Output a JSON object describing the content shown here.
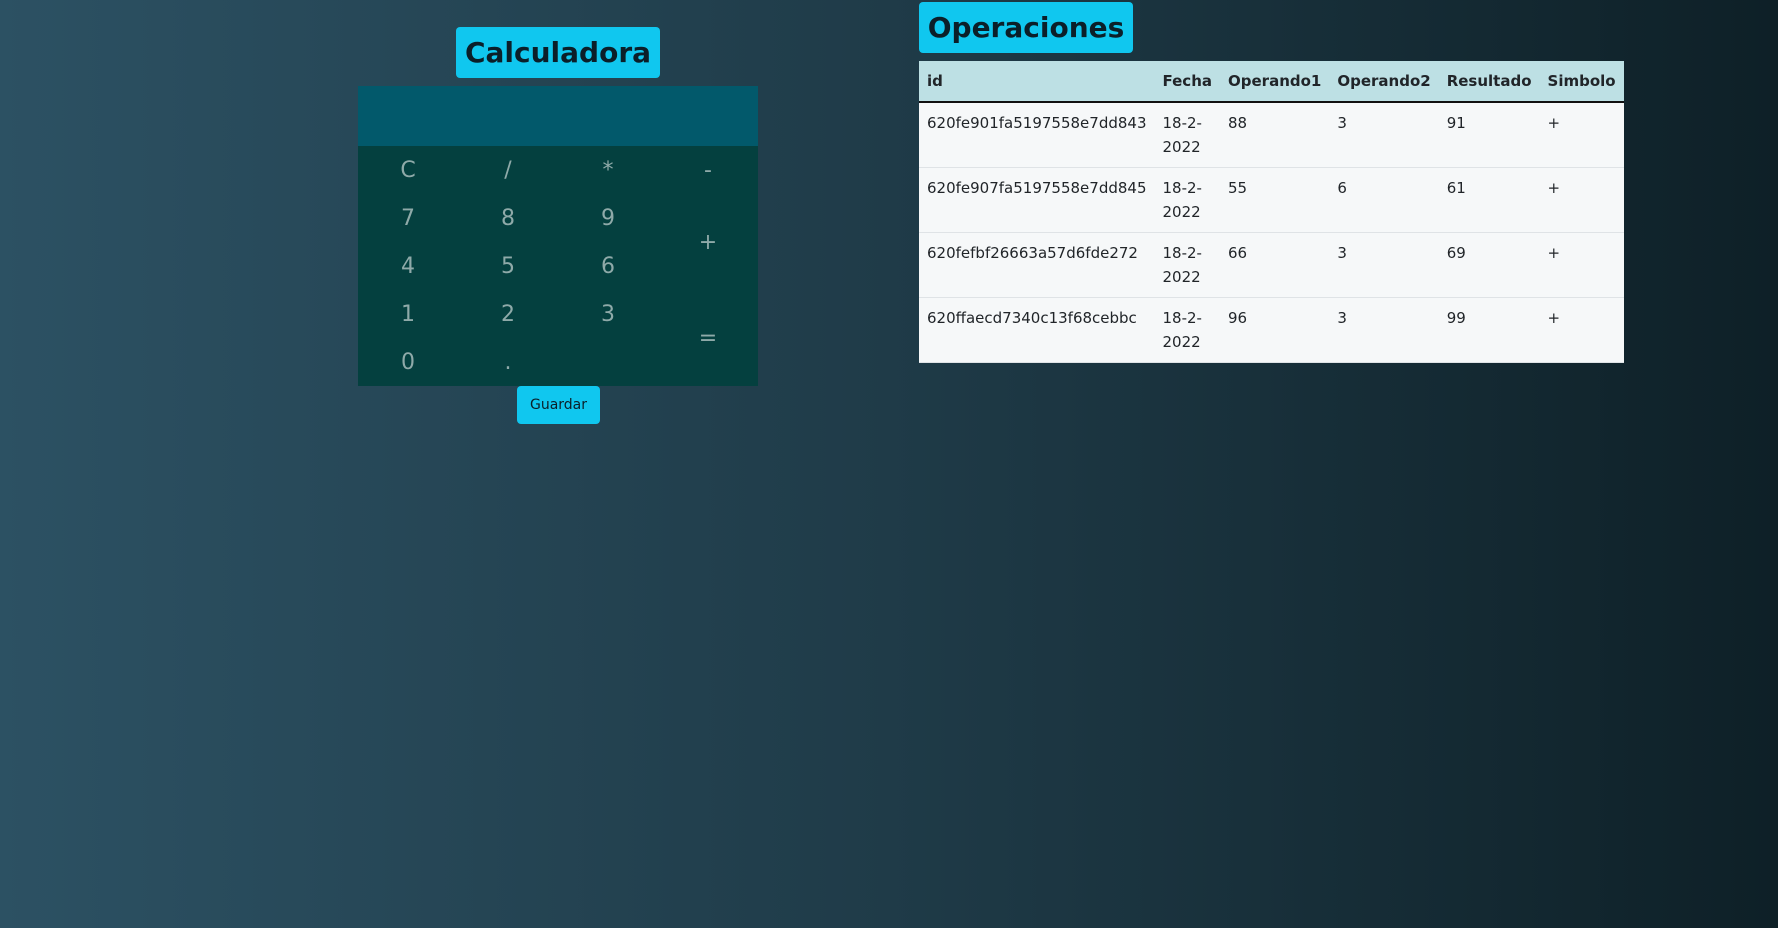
{
  "calculator": {
    "title": "Calculadora",
    "display": "",
    "keys": {
      "clear": "C",
      "divide": "/",
      "multiply": "*",
      "minus": "-",
      "seven": "7",
      "eight": "8",
      "nine": "9",
      "plus": "+",
      "four": "4",
      "five": "5",
      "six": "6",
      "one": "1",
      "two": "2",
      "three": "3",
      "equals": "=",
      "zero": "0",
      "dot": "."
    },
    "save_label": "Guardar"
  },
  "operations": {
    "title": "Operaciones",
    "headers": [
      "id",
      "Fecha",
      "Operando1",
      "Operando2",
      "Resultado",
      "Simbolo"
    ],
    "rows": [
      [
        "620fe901fa5197558e7dd843",
        "18-2-2022",
        "88",
        "3",
        "91",
        "+"
      ],
      [
        "620fe907fa5197558e7dd845",
        "18-2-2022",
        "55",
        "6",
        "61",
        "+"
      ],
      [
        "620fefbf26663a57d6fde272",
        "18-2-2022",
        "66",
        "3",
        "69",
        "+"
      ],
      [
        "620ffaecd7340c13f68cebbc",
        "18-2-2022",
        "96",
        "3",
        "99",
        "+"
      ]
    ]
  },
  "colors": {
    "accent": "#10c7ef",
    "calculator_body": "#04403f",
    "calculator_display": "#02596b",
    "table_header": "#bde0e4"
  }
}
